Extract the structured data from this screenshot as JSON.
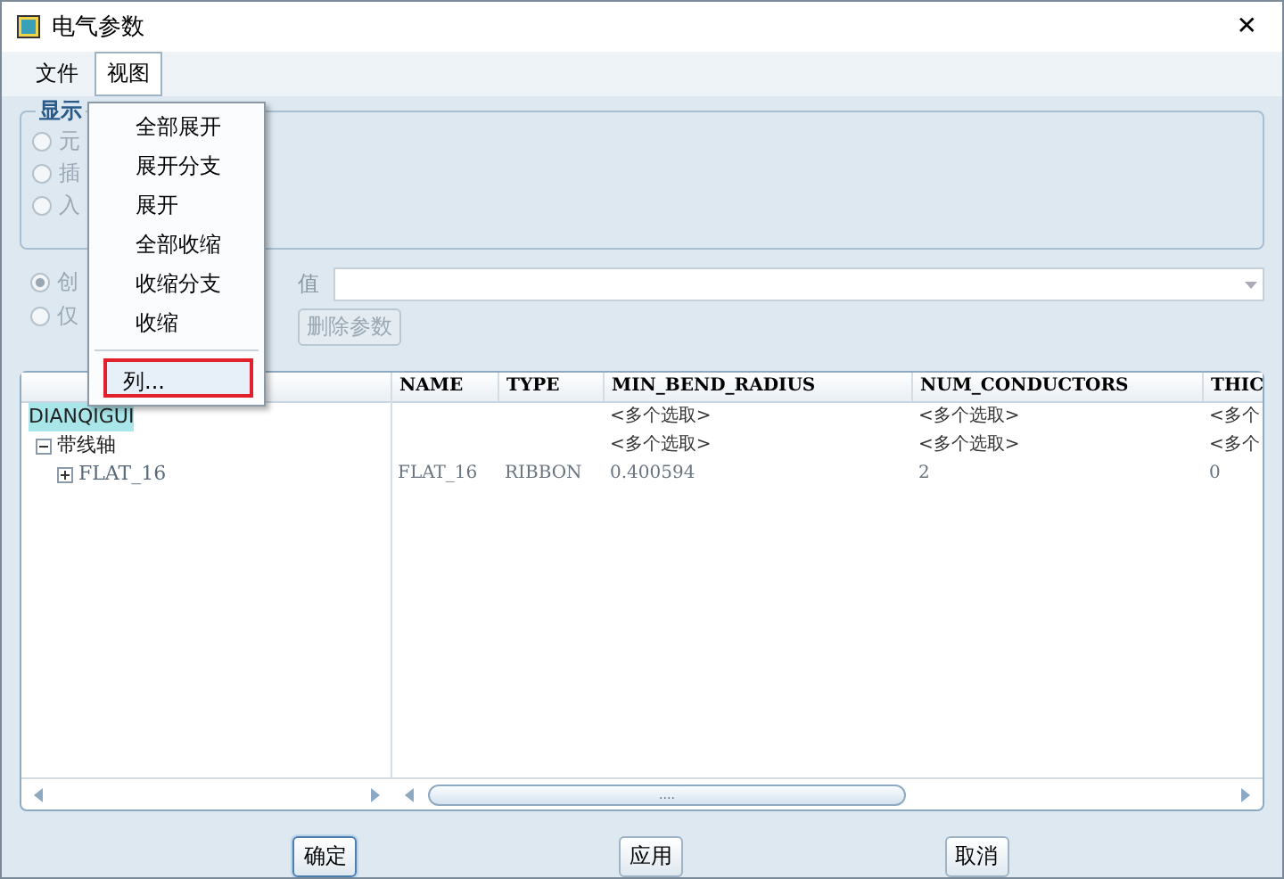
{
  "window": {
    "title": "电气参数",
    "close": "✕"
  },
  "menubar": [
    {
      "label": "文件",
      "selected": false
    },
    {
      "label": "视图",
      "selected": true
    }
  ],
  "menu": {
    "items": [
      {
        "label": "全部展开",
        "highlighted": false
      },
      {
        "label": "展开分支",
        "highlighted": false
      },
      {
        "label": "展开",
        "highlighted": false
      },
      {
        "label": "全部收缩",
        "highlighted": false
      },
      {
        "label": "收缩分支",
        "highlighted": false
      },
      {
        "label": "收缩",
        "highlighted": false
      },
      {
        "label": "列...",
        "highlighted": true
      }
    ]
  },
  "display_group": {
    "title": "显示",
    "radios": [
      {
        "label": "元",
        "selected": false
      },
      {
        "label": "插",
        "selected": false
      },
      {
        "label": "入",
        "selected": false
      }
    ]
  },
  "mode_radios": [
    {
      "label": "创",
      "selected": true
    },
    {
      "label": "仅",
      "selected": false
    }
  ],
  "value_field": {
    "label": "值"
  },
  "delete_button": {
    "label": "删除参数",
    "disabled": true
  },
  "tree": [
    {
      "label": "DIANQIGUI",
      "highlighted": true,
      "children": [
        {
          "label": "带线轴",
          "expanded": true,
          "children": [
            {
              "label": "FLAT_16",
              "expanded": false
            }
          ]
        }
      ]
    }
  ],
  "table": {
    "columns": [
      "NAME",
      "TYPE",
      "MIN_BEND_RADIUS",
      "NUM_CONDUCTORS",
      "THIC"
    ],
    "rows": [
      [
        "",
        "",
        "<多个选取>",
        "<多个选取>",
        "<多个"
      ],
      [
        "",
        "",
        "<多个选取>",
        "<多个选取>",
        "<多个"
      ],
      [
        "FLAT_16",
        "RIBBON",
        "0.400594",
        "2",
        "0"
      ]
    ]
  },
  "scroll_thumb": "....",
  "buttons": [
    {
      "label": "确定",
      "default": true
    },
    {
      "label": "应用",
      "default": false
    },
    {
      "label": "取消",
      "default": false
    }
  ]
}
